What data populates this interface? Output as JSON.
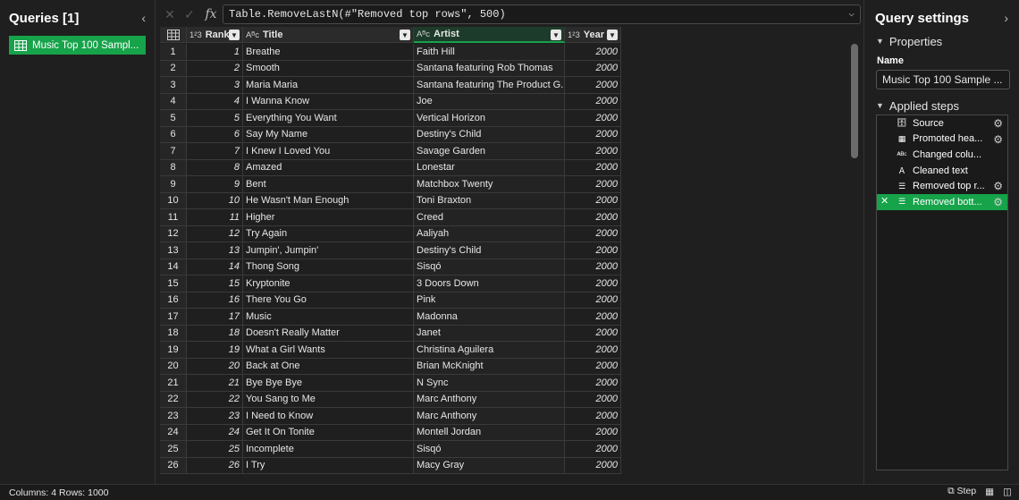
{
  "queries": {
    "title": "Queries [1]",
    "items": [
      {
        "label": "Music Top 100 Sampl..."
      }
    ]
  },
  "formula": {
    "prefix": "Table.RemoveLastN(#",
    "string": "\"Removed top rows\"",
    "suffix": ", 500)"
  },
  "columns": [
    {
      "type": "1²3",
      "label": "Rank"
    },
    {
      "type": "Aᴮc",
      "label": "Title"
    },
    {
      "type": "Aᴮc",
      "label": "Artist"
    },
    {
      "type": "1²3",
      "label": "Year"
    }
  ],
  "rows": [
    {
      "i": "1",
      "rank": "1",
      "title": "Breathe",
      "artist": "Faith Hill",
      "year": "2000"
    },
    {
      "i": "2",
      "rank": "2",
      "title": "Smooth",
      "artist": "Santana featuring Rob Thomas",
      "year": "2000"
    },
    {
      "i": "3",
      "rank": "3",
      "title": "Maria Maria",
      "artist": "Santana featuring The Product G...",
      "year": "2000"
    },
    {
      "i": "4",
      "rank": "4",
      "title": "I Wanna Know",
      "artist": "Joe",
      "year": "2000"
    },
    {
      "i": "5",
      "rank": "5",
      "title": "Everything You Want",
      "artist": "Vertical Horizon",
      "year": "2000"
    },
    {
      "i": "6",
      "rank": "6",
      "title": "Say My Name",
      "artist": "Destiny's Child",
      "year": "2000"
    },
    {
      "i": "7",
      "rank": "7",
      "title": "I Knew I Loved You",
      "artist": "Savage Garden",
      "year": "2000"
    },
    {
      "i": "8",
      "rank": "8",
      "title": "Amazed",
      "artist": "Lonestar",
      "year": "2000"
    },
    {
      "i": "9",
      "rank": "9",
      "title": "Bent",
      "artist": "Matchbox Twenty",
      "year": "2000"
    },
    {
      "i": "10",
      "rank": "10",
      "title": "He Wasn't Man Enough",
      "artist": "Toni Braxton",
      "year": "2000"
    },
    {
      "i": "11",
      "rank": "11",
      "title": "Higher",
      "artist": "Creed",
      "year": "2000"
    },
    {
      "i": "12",
      "rank": "12",
      "title": "Try Again",
      "artist": "Aaliyah",
      "year": "2000"
    },
    {
      "i": "13",
      "rank": "13",
      "title": "Jumpin', Jumpin'",
      "artist": "Destiny's Child",
      "year": "2000"
    },
    {
      "i": "14",
      "rank": "14",
      "title": "Thong Song",
      "artist": "Sisqó",
      "year": "2000"
    },
    {
      "i": "15",
      "rank": "15",
      "title": "Kryptonite",
      "artist": "3 Doors Down",
      "year": "2000"
    },
    {
      "i": "16",
      "rank": "16",
      "title": "There You Go",
      "artist": "Pink",
      "year": "2000"
    },
    {
      "i": "17",
      "rank": "17",
      "title": "Music",
      "artist": "Madonna",
      "year": "2000"
    },
    {
      "i": "18",
      "rank": "18",
      "title": "Doesn't Really Matter",
      "artist": "Janet",
      "year": "2000"
    },
    {
      "i": "19",
      "rank": "19",
      "title": "What a Girl Wants",
      "artist": "Christina Aguilera",
      "year": "2000"
    },
    {
      "i": "20",
      "rank": "20",
      "title": "Back at One",
      "artist": "Brian McKnight",
      "year": "2000"
    },
    {
      "i": "21",
      "rank": "21",
      "title": "Bye Bye Bye",
      "artist": "N Sync",
      "year": "2000"
    },
    {
      "i": "22",
      "rank": "22",
      "title": "You Sang to Me",
      "artist": "Marc Anthony",
      "year": "2000"
    },
    {
      "i": "23",
      "rank": "23",
      "title": "I Need to Know",
      "artist": "Marc Anthony",
      "year": "2000"
    },
    {
      "i": "24",
      "rank": "24",
      "title": "Get It On Tonite",
      "artist": "Montell Jordan",
      "year": "2000"
    },
    {
      "i": "25",
      "rank": "25",
      "title": "Incomplete",
      "artist": "Sisqó",
      "year": "2000"
    },
    {
      "i": "26",
      "rank": "26",
      "title": "I Try",
      "artist": "Macy Gray",
      "year": "2000"
    }
  ],
  "settings": {
    "title": "Query settings",
    "properties_label": "Properties",
    "name_label": "Name",
    "name_value": "Music Top 100 Sample ...",
    "applied_steps_label": "Applied steps",
    "steps": [
      {
        "label": "Source",
        "icon": "source-icon",
        "gear": true
      },
      {
        "label": "Promoted hea...",
        "icon": "table-icon",
        "gear": true
      },
      {
        "label": "Changed colu...",
        "icon": "abc-123-icon",
        "gear": false
      },
      {
        "label": "Cleaned text",
        "icon": "text-icon",
        "gear": false
      },
      {
        "label": "Removed top r...",
        "icon": "remove-rows-icon",
        "gear": true
      },
      {
        "label": "Removed bott...",
        "icon": "remove-rows-icon",
        "gear": true
      }
    ]
  },
  "status": {
    "text": "Columns: 4   Rows: 1000",
    "step_label": "Step"
  },
  "colors": {
    "accent": "#16a34a",
    "background": "#1f1f1f"
  }
}
